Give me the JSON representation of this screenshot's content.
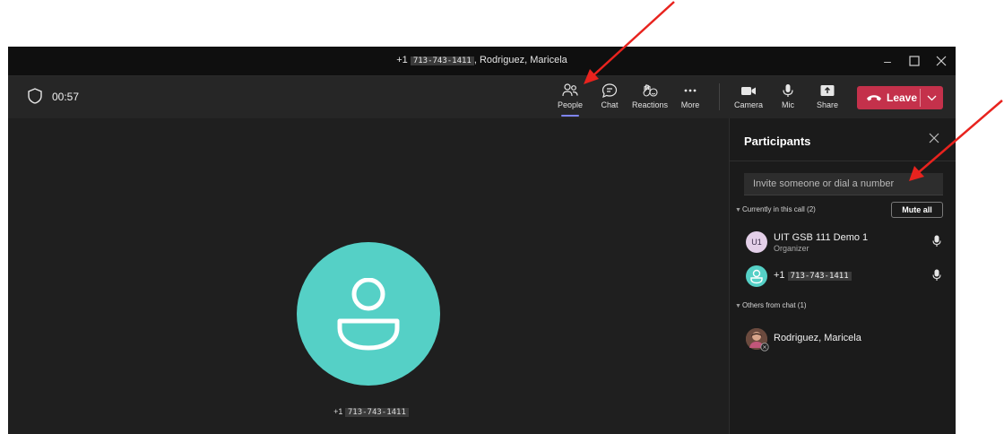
{
  "window": {
    "title_prefix": "+1",
    "title_phone": "713-743-1411",
    "title_suffix": ", Rodriguez, Maricela"
  },
  "controls": {
    "minimize_icon": "minimize-icon",
    "maximize_icon": "maximize-icon",
    "close_icon": "close-icon"
  },
  "toolbar": {
    "timer": "00:57",
    "people": "People",
    "chat": "Chat",
    "reactions": "Reactions",
    "more": "More",
    "camera": "Camera",
    "mic": "Mic",
    "share": "Share",
    "leave": "Leave"
  },
  "stage": {
    "caller_prefix": "+1",
    "caller_phone": "713-743-1411"
  },
  "participants": {
    "title": "Participants",
    "invite_placeholder": "Invite someone or dial a number",
    "in_call_label": "Currently in this call (2)",
    "mute_all": "Mute all",
    "members": [
      {
        "initials": "U1",
        "name": "UIT GSB 111 Demo 1",
        "role": "Organizer"
      },
      {
        "prefix": "+1",
        "phone": "713-743-1411"
      }
    ],
    "others_label": "Others from chat (1)",
    "others": [
      {
        "name": "Rodriguez, Maricela"
      }
    ]
  },
  "colors": {
    "accent": "#7f85f5",
    "leave": "#c4314b",
    "avatar": "#55d0c6",
    "annotation_arrow": "#e8231e"
  }
}
